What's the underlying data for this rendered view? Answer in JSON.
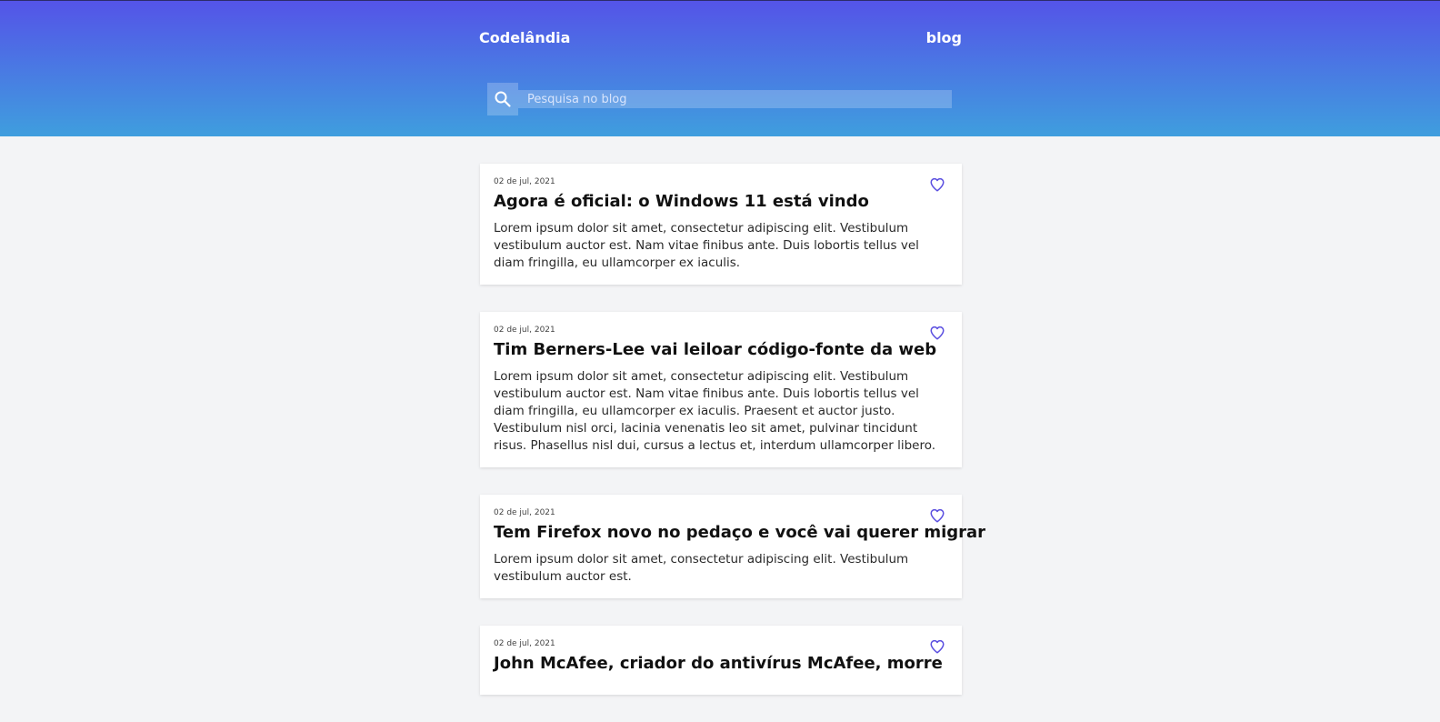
{
  "header": {
    "brand": "Codelândia",
    "nav_link": "blog",
    "search_placeholder": "Pesquisa no blog"
  },
  "colors": {
    "header_gradient_top": "#5454e8",
    "header_gradient_bottom": "#3f9ede",
    "heart_accent": "#5a4ee0",
    "page_background": "#f3f4f6"
  },
  "icons": {
    "search": "search-icon",
    "like": "heart-icon"
  },
  "posts": [
    {
      "date": "02 de jul, 2021",
      "title": "Agora é oficial: o Windows 11 está vindo",
      "excerpt": "Lorem ipsum dolor sit amet, consectetur adipiscing elit. Vestibulum vestibulum auctor est. Nam vitae finibus ante. Duis lobortis tellus vel diam fringilla, eu ullamcorper ex iaculis."
    },
    {
      "date": "02 de jul, 2021",
      "title": "Tim Berners-Lee vai leiloar código-fonte da web",
      "excerpt": "Lorem ipsum dolor sit amet, consectetur adipiscing elit. Vestibulum vestibulum auctor est. Nam vitae finibus ante. Duis lobortis tellus vel diam fringilla, eu ullamcorper ex iaculis. Praesent et auctor justo. Vestibulum nisl orci, lacinia venenatis leo sit amet, pulvinar tincidunt risus. Phasellus nisl dui, cursus a lectus et, interdum ullamcorper libero."
    },
    {
      "date": "02 de jul, 2021",
      "title": "Tem Firefox novo no pedaço e você vai querer migrar",
      "excerpt": "Lorem ipsum dolor sit amet, consectetur adipiscing elit. Vestibulum vestibulum auctor est."
    },
    {
      "date": "02 de jul, 2021",
      "title": "John McAfee, criador do antivírus McAfee, morre",
      "excerpt": ""
    }
  ]
}
